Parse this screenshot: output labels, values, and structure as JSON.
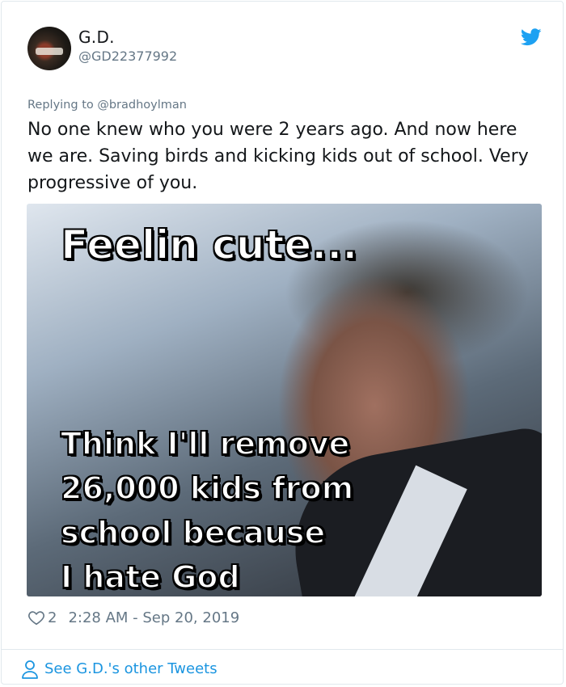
{
  "tweet": {
    "author_name": "G.D.",
    "author_handle": "@GD22377992",
    "replying_to": "Replying to @bradhoylman",
    "text": "No one knew who you were 2 years ago. And now here we are. Saving birds and kicking kids out of school. Very progressive of you.",
    "likes": "2",
    "timestamp": "2:28 AM - Sep 20, 2019",
    "brand_color": "#1da1f2"
  },
  "media": {
    "meme_top": "Feelin cute...",
    "meme_bottom_lines": [
      "Think I'll remove",
      "26,000 kids from",
      "school because",
      "I hate God"
    ]
  },
  "footer": {
    "see_more": "See G.D.'s other Tweets",
    "link_color": "#1b95e0"
  },
  "icons": [
    "twitter-bird-icon",
    "heart-icon",
    "person-icon"
  ]
}
